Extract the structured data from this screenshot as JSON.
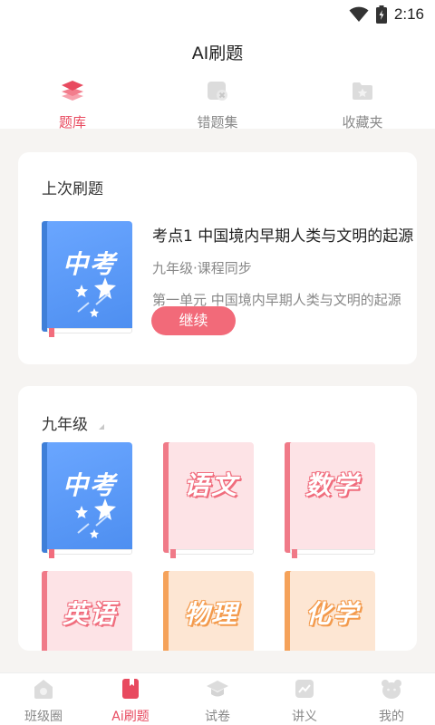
{
  "status": {
    "time": "2:16"
  },
  "app": {
    "title": "AI刷题"
  },
  "top_tabs": [
    {
      "label": "题库",
      "icon": "layers-icon",
      "active": true
    },
    {
      "label": "错题集",
      "icon": "wrong-questions-icon",
      "active": false
    },
    {
      "label": "收藏夹",
      "icon": "favorites-folder-icon",
      "active": false
    }
  ],
  "last_practice": {
    "section_title": "上次刷题",
    "book_title": "中考",
    "title": "考点1 中国境内早期人类与文明的起源",
    "subtitle": "九年级·课程同步",
    "description": "第一单元 中国境内早期人类与文明的起源",
    "button": "继续"
  },
  "grade": {
    "title": "九年级",
    "books": [
      {
        "title": "中考",
        "style": "blue"
      },
      {
        "title": "语文",
        "style": "pink"
      },
      {
        "title": "数学",
        "style": "pink"
      },
      {
        "title": "英语",
        "style": "pink"
      },
      {
        "title": "物理",
        "style": "orange"
      },
      {
        "title": "化学",
        "style": "orange"
      }
    ]
  },
  "bottom_nav": [
    {
      "label": "班级圈",
      "icon": "class-circle-icon",
      "active": false
    },
    {
      "label": "Ai刷题",
      "icon": "ai-practice-icon",
      "active": true
    },
    {
      "label": "试卷",
      "icon": "exam-paper-icon",
      "active": false
    },
    {
      "label": "讲义",
      "icon": "handout-icon",
      "active": false
    },
    {
      "label": "我的",
      "icon": "profile-icon",
      "active": false
    }
  ],
  "colors": {
    "accent": "#e84a5f",
    "button": "#f26a79",
    "background": "#f6f4f2"
  }
}
